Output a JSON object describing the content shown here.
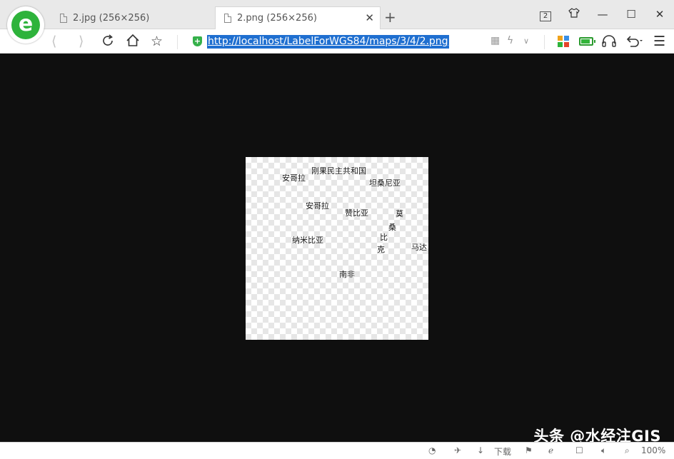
{
  "tabs": [
    {
      "title": "2.jpg (256×256)"
    },
    {
      "title": "2.png (256×256)",
      "active": true
    }
  ],
  "window": {
    "tab_count": "2"
  },
  "address_bar": {
    "url": "http://localhost/LabelForWGS84/maps/3/4/2.png"
  },
  "map_labels": [
    {
      "text": "刚果民主共和国"
    },
    {
      "text": "安哥拉"
    },
    {
      "text": "坦桑尼亚"
    },
    {
      "text": "安哥拉"
    },
    {
      "text": "赞比亚"
    },
    {
      "text": "莫"
    },
    {
      "text": "桑"
    },
    {
      "text": "比"
    },
    {
      "text": "纳米比亚"
    },
    {
      "text": "克"
    },
    {
      "text": "马达"
    },
    {
      "text": "南非"
    }
  ],
  "status_bar": {
    "download_label": "下载",
    "zoom": "100%"
  },
  "watermark": "头条 @水经注GIS",
  "colors": {
    "url_highlight": "#1f6fd0",
    "logo_green": "#2eb33b",
    "viewport_bg": "#0f0f0f"
  },
  "icons": [
    "browser-logo-icon",
    "document-icon",
    "close-icon",
    "plus-icon",
    "back-icon",
    "forward-icon",
    "refresh-icon",
    "home-icon",
    "star-icon",
    "shield-icon",
    "qr-code-icon",
    "lightning-icon",
    "chevron-down-icon",
    "apps-icon",
    "battery-icon",
    "headphones-icon",
    "undo-icon",
    "menu-icon",
    "skin-icon",
    "minimize-icon",
    "maximize-icon"
  ]
}
